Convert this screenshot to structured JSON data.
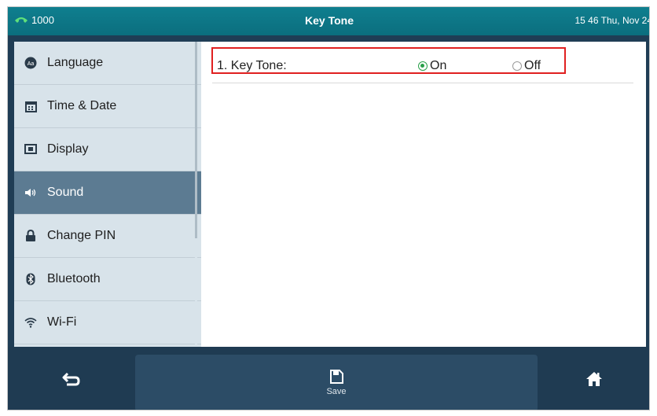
{
  "status_bar": {
    "extension": "1000",
    "title": "Key Tone",
    "datetime": "15 46 Thu, Nov 24"
  },
  "sidebar": {
    "items": [
      {
        "label": "Language",
        "icon": "language-icon",
        "active": false
      },
      {
        "label": "Time & Date",
        "icon": "calendar-icon",
        "active": false
      },
      {
        "label": "Display",
        "icon": "display-icon",
        "active": false
      },
      {
        "label": "Sound",
        "icon": "speaker-icon",
        "active": true
      },
      {
        "label": "Change PIN",
        "icon": "lock-icon",
        "active": false
      },
      {
        "label": "Bluetooth",
        "icon": "bluetooth-icon",
        "active": false
      },
      {
        "label": "Wi-Fi",
        "icon": "wifi-icon",
        "active": false
      }
    ]
  },
  "content": {
    "setting_label": "1. Key Tone:",
    "options": [
      "On",
      "Off"
    ],
    "selected": "On"
  },
  "bottom_bar": {
    "save_label": "Save",
    "back_icon": "back-arrow-icon",
    "save_icon": "save-icon",
    "home_icon": "home-icon"
  },
  "colors": {
    "status_bar": "#0b6e7e",
    "sidebar_bg": "#d8e3ea",
    "active_item": "#5c7b92",
    "bottom_bar": "#1f3b52",
    "radio_on": "#2aa04a",
    "highlight_border": "#e02020"
  }
}
